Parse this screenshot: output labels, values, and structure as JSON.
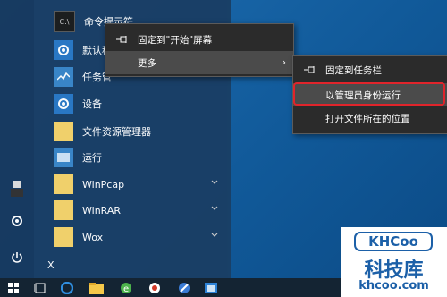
{
  "start_menu": {
    "apps": [
      {
        "label": "命令提示符",
        "icon": "cmd-icon"
      },
      {
        "label": "默认程",
        "icon": "gear-icon"
      },
      {
        "label": "任务管",
        "icon": "task-manager-icon"
      },
      {
        "label": "设备",
        "icon": "gear-icon"
      },
      {
        "label": "文件资源管理器",
        "icon": "folder-icon"
      },
      {
        "label": "运行",
        "icon": "run-icon"
      },
      {
        "label": "WinPcap",
        "icon": "folder-icon"
      },
      {
        "label": "WinRAR",
        "icon": "folder-icon"
      },
      {
        "label": "Wox",
        "icon": "folder-icon"
      }
    ],
    "section_letter": "X"
  },
  "context_menu": {
    "items": [
      {
        "label": "固定到\"开始\"屏幕"
      },
      {
        "label": "更多"
      }
    ]
  },
  "sub_menu": {
    "items": [
      {
        "label": "固定到任务栏"
      },
      {
        "label": "以管理员身份运行"
      },
      {
        "label": "打开文件所在的位置"
      }
    ]
  },
  "watermark": {
    "logo": "KHCoo",
    "chinese": "科技库",
    "url": "khcoo.com"
  },
  "colors": {
    "accent": "#2a78c5",
    "highlight_outline": "#e0242b"
  }
}
